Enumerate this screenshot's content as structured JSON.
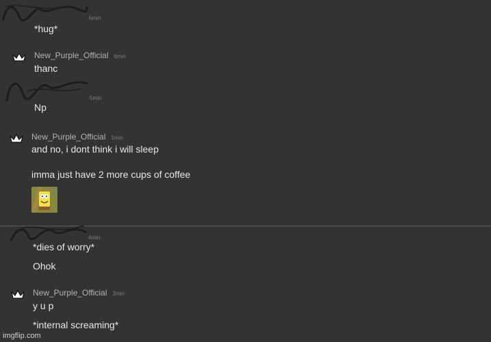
{
  "messages": [
    {
      "username": "",
      "time": "6min",
      "lines": [
        "*hug*"
      ]
    },
    {
      "username": "New_Purple_Official",
      "time": "6min",
      "lines": [
        "thanc"
      ]
    },
    {
      "username": "",
      "time": "5min",
      "lines": [
        "Np"
      ]
    },
    {
      "username": "New_Purple_Official",
      "time": "1min",
      "lines": [
        "and no, i dont think i will sleep",
        "imma just have 2 more cups of coffee"
      ],
      "attachment": "spongebob-rainbow-sticker"
    },
    {
      "username": "",
      "time": "4min",
      "lines": [
        "*dies of worry*",
        "Ohok"
      ]
    },
    {
      "username": "New_Purple_Official",
      "time": "3min",
      "lines": [
        "y u p",
        "*internal screaming*"
      ]
    }
  ],
  "watermark": "imgflip.com",
  "colors": {
    "background": "#333333",
    "text": "#e8e8e8",
    "username": "#b3b3b3",
    "timestamp": "#7d7d7d"
  },
  "icons": {
    "avatar": "crown-icon",
    "sticker": "spongebob-sticker"
  }
}
